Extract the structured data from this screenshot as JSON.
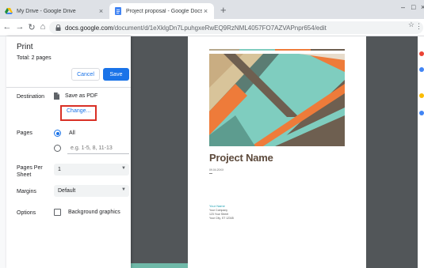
{
  "browser": {
    "tabs": [
      {
        "title": "My Drive - Google Drive",
        "icon": "google-drive-icon",
        "active": false
      },
      {
        "title": "Project proposal - Google Docs",
        "icon": "google-docs-icon",
        "active": true
      }
    ],
    "url_host": "docs.google.com",
    "url_path": "/document/d/1eXklgDn7LpuhgxeRwEQ9RzNML4057FO7AZVAPnpr654/edit"
  },
  "print": {
    "title": "Print",
    "total": "Total: 2 pages",
    "cancel_label": "Cancel",
    "save_label": "Save",
    "destination_label": "Destination",
    "destination_value": "Save as PDF",
    "change_label": "Change...",
    "pages_label": "Pages",
    "pages_all": "All",
    "pages_custom_placeholder": "e.g. 1-5, 8, 11-13",
    "pages_per_sheet_label": "Pages Per Sheet",
    "pages_per_sheet_value": "1",
    "margins_label": "Margins",
    "margins_value": "Default",
    "options_label": "Options",
    "background_graphics_label": "Background graphics"
  },
  "preview": {
    "project_name": "Project Name",
    "date": "09.04.20XX",
    "dash": "—",
    "your_name": "Your Name",
    "company": "Your Company",
    "street": "123 Your Street",
    "city": "Your City, ST 12345"
  },
  "colors": {
    "accent": "#1a73e8",
    "highlight": "#d93025",
    "preview_bg": "#525659",
    "title_brown": "#5d4a3c",
    "teal": "#1a9fb0"
  }
}
